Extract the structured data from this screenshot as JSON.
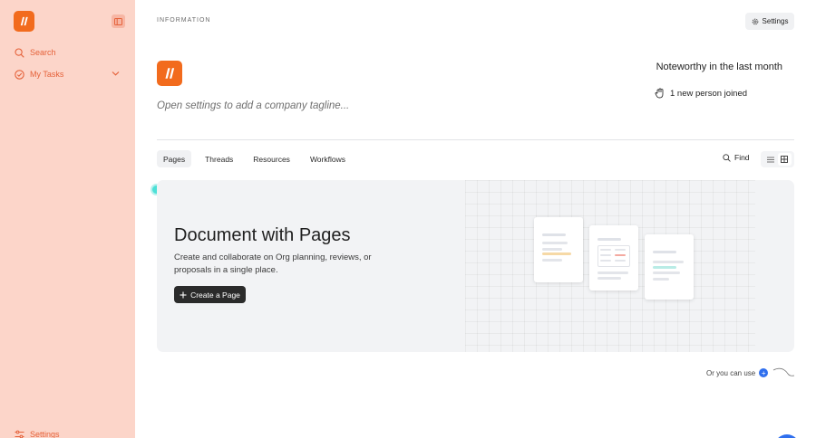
{
  "sidebar": {
    "search_label": "Search",
    "my_tasks_label": "My Tasks",
    "settings_label": "Settings"
  },
  "header": {
    "section_label": "INFORMATION",
    "settings_label": "Settings"
  },
  "company": {
    "tagline_placeholder": "Open settings to add a company tagline..."
  },
  "noteworthy": {
    "title": "Noteworthy in the last month",
    "items": [
      {
        "icon": "wave-hand-icon",
        "text": "1 new person joined"
      }
    ]
  },
  "tabs": [
    {
      "label": "Pages",
      "active": true
    },
    {
      "label": "Threads",
      "active": false
    },
    {
      "label": "Resources",
      "active": false
    },
    {
      "label": "Workflows",
      "active": false
    }
  ],
  "toolbar": {
    "find_label": "Find",
    "view_mode": "grid"
  },
  "empty_state": {
    "title": "Document with Pages",
    "description": "Create and collaborate on Org planning, reviews, or proposals in a single place.",
    "create_label": "Create a Page"
  },
  "footer": {
    "alt_label": "Or you can use"
  },
  "colors": {
    "sidebar_bg": "#fcd5c9",
    "accent": "#f26b1d",
    "sidebar_text": "#e5623a",
    "panel_bg": "#f2f3f5",
    "primary_button": "#2b2b2b",
    "pointer": "#4de0d7",
    "blue": "#2f6fee"
  }
}
